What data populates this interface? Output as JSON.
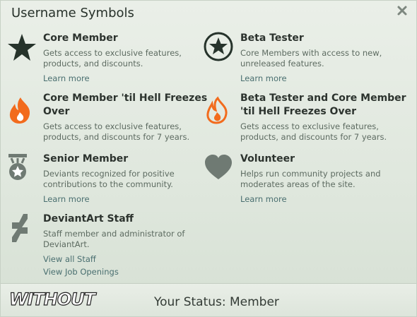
{
  "title": "Username Symbols",
  "close_icon": "close-x-icon",
  "entries": [
    {
      "icon": "star-icon",
      "name": "Core Member",
      "desc1": "Gets access to exclusive features,",
      "desc2": "products, and discounts.",
      "link": "Learn more"
    },
    {
      "icon": "circled-star-icon",
      "name": "Beta Tester",
      "desc1": "Core Members with access to new,",
      "desc2": "unreleased features.",
      "link": "Learn more"
    },
    {
      "icon": "flame-icon",
      "name1": "Core Member 'til Hell Freezes",
      "name2": "Over",
      "desc1": "Gets access to exclusive features,",
      "desc2": "products, and discounts for 7 years."
    },
    {
      "icon": "flame-outline-icon",
      "name1": "Beta Tester and Core Member",
      "name2": "'til Hell Freezes Over",
      "desc1": "Gets access to exclusive features,",
      "desc2": "products, and discounts for 7 years."
    },
    {
      "icon": "medal-icon",
      "name": "Senior Member",
      "desc1": "Deviants recognized for positive",
      "desc2": "contributions to the community.",
      "link": "Learn more"
    },
    {
      "icon": "heart-icon",
      "name": "Volunteer",
      "desc1": "Helps run community projects and",
      "desc2": "moderates areas of the site.",
      "link": "Learn more"
    },
    {
      "icon": "deviantart-logo-icon",
      "name": "DeviantArt Staff",
      "desc1": "Staff member and administrator of",
      "desc2": "DeviantArt.",
      "link1": "View all Staff",
      "link2": "View Job Openings"
    }
  ],
  "footer": {
    "brand": "WITHOUT",
    "status": "Your Status: Member"
  },
  "colors": {
    "flame": "#f26b1d",
    "icon_dark": "#26332b",
    "icon_grey": "#6f7a73",
    "link": "#4a6f70"
  }
}
